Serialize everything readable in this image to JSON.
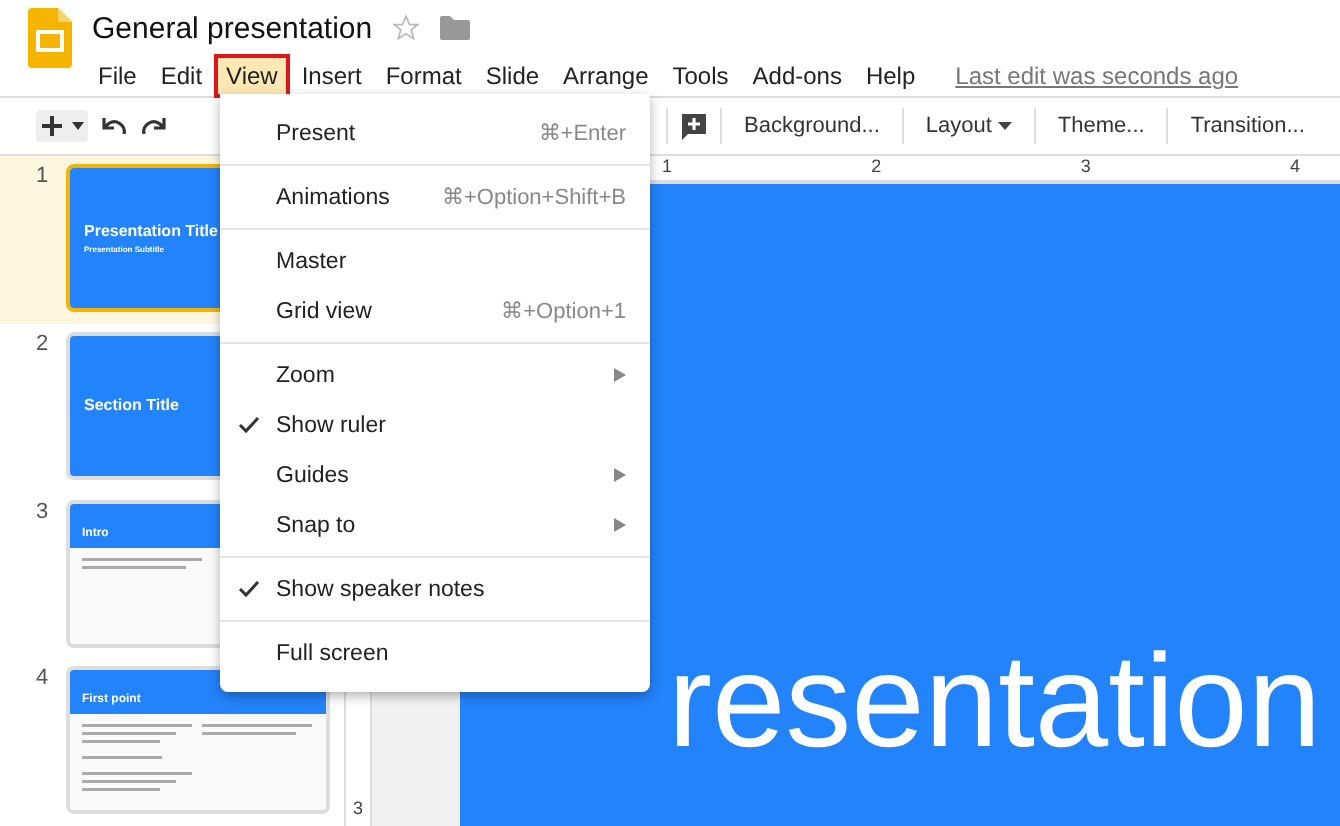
{
  "document": {
    "title": "General presentation"
  },
  "menu_bar": [
    {
      "label": "File",
      "selected": false
    },
    {
      "label": "Edit",
      "selected": false
    },
    {
      "label": "View",
      "selected": true
    },
    {
      "label": "Insert",
      "selected": false
    },
    {
      "label": "Format",
      "selected": false
    },
    {
      "label": "Slide",
      "selected": false
    },
    {
      "label": "Arrange",
      "selected": false
    },
    {
      "label": "Tools",
      "selected": false
    },
    {
      "label": "Add-ons",
      "selected": false
    },
    {
      "label": "Help",
      "selected": false
    }
  ],
  "last_edit": "Last edit was seconds ago",
  "toolbar": {
    "right_buttons": [
      {
        "label": "Background...",
        "dropdown": false
      },
      {
        "label": "Layout",
        "dropdown": true
      },
      {
        "label": "Theme...",
        "dropdown": false
      },
      {
        "label": "Transition...",
        "dropdown": false
      }
    ]
  },
  "ruler": {
    "ticks": [
      "1",
      "2",
      "3",
      "4"
    ],
    "vertical_tick": "3"
  },
  "slides": [
    {
      "number": "1",
      "selected": true,
      "kind": "title",
      "title": "Presentation Title",
      "subtitle": "Presentation Subtitle"
    },
    {
      "number": "2",
      "selected": false,
      "kind": "section",
      "title": "Section Title"
    },
    {
      "number": "3",
      "selected": false,
      "kind": "header",
      "title": "Intro"
    },
    {
      "number": "4",
      "selected": false,
      "kind": "columns",
      "title": "First point"
    }
  ],
  "view_menu": {
    "sections": [
      [
        {
          "label": "Present",
          "shortcut": "⌘+Enter",
          "checked": false,
          "submenu": false
        }
      ],
      [
        {
          "label": "Animations",
          "shortcut": "⌘+Option+Shift+B",
          "checked": false,
          "submenu": false
        }
      ],
      [
        {
          "label": "Master",
          "checked": false,
          "submenu": false
        },
        {
          "label": "Grid view",
          "shortcut": "⌘+Option+1",
          "checked": false,
          "submenu": false
        }
      ],
      [
        {
          "label": "Zoom",
          "checked": false,
          "submenu": true
        },
        {
          "label": "Show ruler",
          "checked": true,
          "submenu": false
        },
        {
          "label": "Guides",
          "checked": false,
          "submenu": true
        },
        {
          "label": "Snap to",
          "checked": false,
          "submenu": true
        }
      ],
      [
        {
          "label": "Show speaker notes",
          "checked": true,
          "submenu": false
        }
      ],
      [
        {
          "label": "Full screen",
          "checked": false,
          "submenu": false
        }
      ]
    ]
  },
  "canvas": {
    "slide_text": "resentation"
  }
}
